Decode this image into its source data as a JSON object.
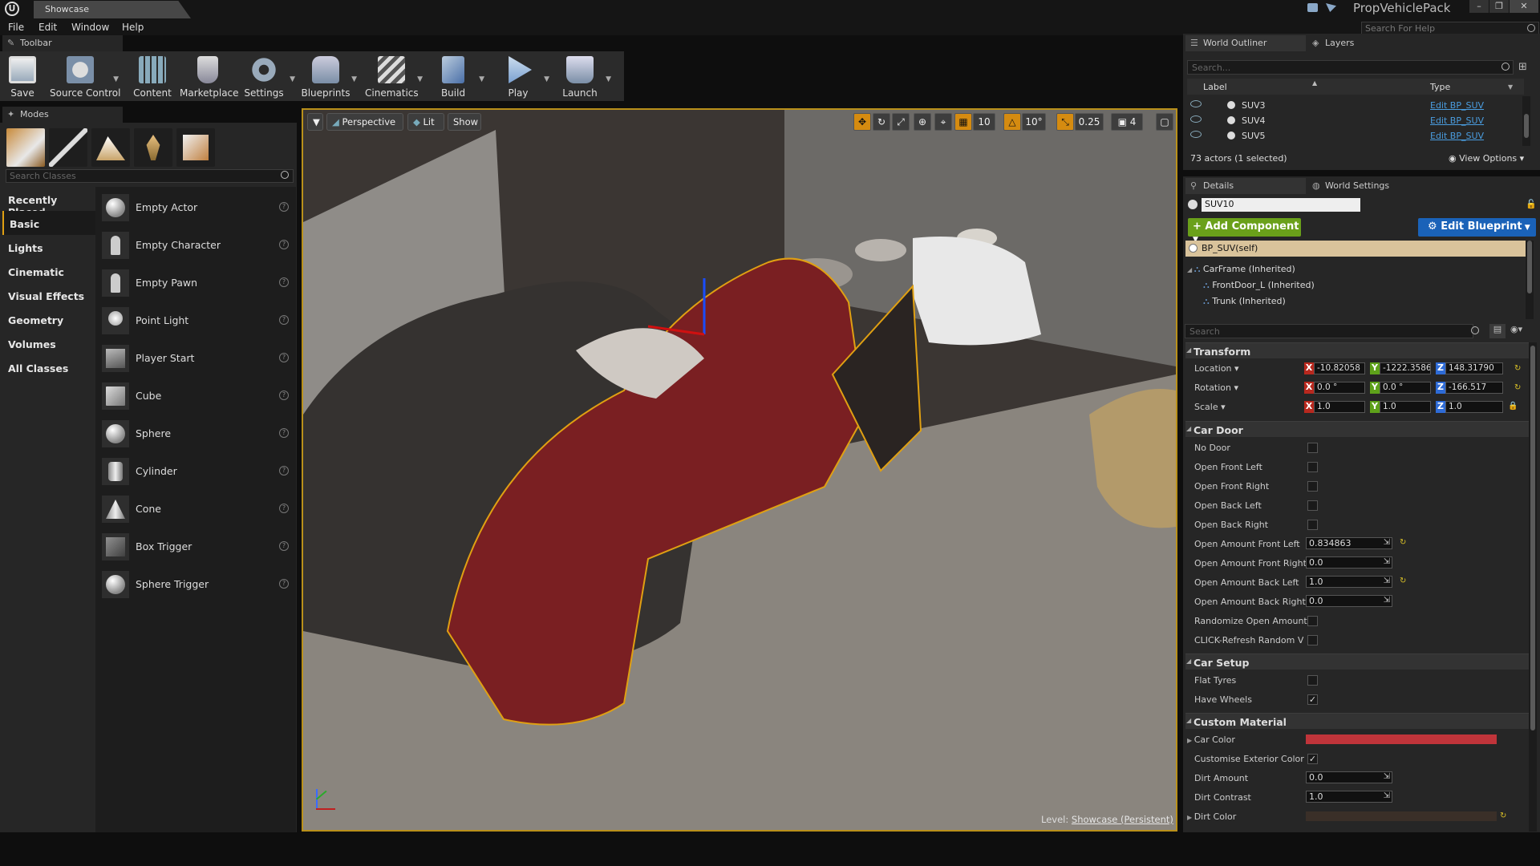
{
  "title_bar": {
    "document_tab": "Showcase",
    "project_name": "PropVehiclePack",
    "help_search_placeholder": "Search For Help"
  },
  "menu": [
    "File",
    "Edit",
    "Window",
    "Help"
  ],
  "toolbar": {
    "tab_label": "Toolbar",
    "buttons": [
      {
        "label": "Save",
        "icon": "save-icon"
      },
      {
        "label": "Source Control",
        "icon": "source-control-icon"
      },
      {
        "label": "Content",
        "icon": "content-browser-icon"
      },
      {
        "label": "Marketplace",
        "icon": "marketplace-icon"
      },
      {
        "label": "Settings",
        "icon": "settings-gear-icon"
      },
      {
        "label": "Blueprints",
        "icon": "blueprints-icon"
      },
      {
        "label": "Cinematics",
        "icon": "cinematics-clapper-icon"
      },
      {
        "label": "Build",
        "icon": "build-icon"
      },
      {
        "label": "Play",
        "icon": "play-icon"
      },
      {
        "label": "Launch",
        "icon": "launch-icon"
      }
    ]
  },
  "modes": {
    "tab_label": "Modes",
    "search_placeholder": "Search Classes",
    "categories": [
      "Recently Placed",
      "Basic",
      "Lights",
      "Cinematic",
      "Visual Effects",
      "Geometry",
      "Volumes",
      "All Classes"
    ],
    "selected_category": "Basic",
    "items": [
      "Empty Actor",
      "Empty Character",
      "Empty Pawn",
      "Point Light",
      "Player Start",
      "Cube",
      "Sphere",
      "Cylinder",
      "Cone",
      "Box Trigger",
      "Sphere Trigger"
    ]
  },
  "viewport": {
    "view_mode": "Perspective",
    "lighting": "Lit",
    "show": "Show",
    "grid_snap": "10",
    "rotation_snap": "10°",
    "scale_snap": "0.25",
    "camera_speed": "4",
    "level_label": "Level:",
    "level_name": "Showcase (Persistent)"
  },
  "world_outliner": {
    "tab_label": "World Outliner",
    "layers_tab": "Layers",
    "search_placeholder": "Search...",
    "col_label": "Label",
    "col_type": "Type",
    "rows": [
      {
        "label": "SUV3",
        "type": "Edit BP_SUV"
      },
      {
        "label": "SUV4",
        "type": "Edit BP_SUV"
      },
      {
        "label": "SUV5",
        "type": "Edit BP_SUV"
      }
    ],
    "actor_count": "73 actors (1 selected)",
    "view_options": "View Options"
  },
  "details": {
    "tab_label": "Details",
    "world_settings_tab": "World Settings",
    "actor_name": "SUV10",
    "add_component": "+ Add Component",
    "edit_blueprint": "Edit Blueprint",
    "components": [
      "BP_SUV(self)",
      "CarFrame (Inherited)",
      "FrontDoor_L (Inherited)",
      "Trunk (Inherited)"
    ],
    "search_placeholder": "Search",
    "transform": {
      "header": "Transform",
      "location_label": "Location",
      "rotation_label": "Rotation",
      "scale_label": "Scale",
      "location": [
        "-10.82058",
        "-1222.3586",
        "148.31790"
      ],
      "rotation": [
        "0.0 °",
        "0.0 °",
        "-166.517"
      ],
      "scale": [
        "1.0",
        "1.0",
        "1.0"
      ]
    },
    "car_door": {
      "header": "Car Door",
      "checkboxes": [
        {
          "label": "No Door",
          "checked": false
        },
        {
          "label": "Open Front Left",
          "checked": false
        },
        {
          "label": "Open Front Right",
          "checked": false
        },
        {
          "label": "Open Back Left",
          "checked": false
        },
        {
          "label": "Open Back Right",
          "checked": false
        }
      ],
      "amounts": [
        {
          "label": "Open Amount Front Left",
          "value": "0.834863"
        },
        {
          "label": "Open Amount Front Right",
          "value": "0.0"
        },
        {
          "label": "Open Amount Back Left",
          "value": "1.0"
        },
        {
          "label": "Open Amount Back Right",
          "value": "0.0"
        }
      ],
      "randomize_label": "Randomize Open Amount",
      "refresh_label": "CLICK-Refresh Random Va"
    },
    "car_setup": {
      "header": "Car Setup",
      "flat_tyres": "Flat Tyres",
      "flat_tyres_checked": false,
      "have_wheels": "Have Wheels",
      "have_wheels_checked": true
    },
    "custom_material": {
      "header": "Custom Material",
      "car_color_label": "Car Color",
      "car_color": "#c0343a",
      "customise_label": "Customise Exterior Color",
      "customise_checked": true,
      "dirt_amount_label": "Dirt Amount",
      "dirt_amount": "0.0",
      "dirt_contrast_label": "Dirt Contrast",
      "dirt_contrast": "1.0",
      "dirt_color_label": "Dirt Color",
      "dirt_color": "#3a2f28"
    }
  },
  "colors": {
    "selection_outline": "#e0a012",
    "add_component_green": "#6aa01a",
    "edit_blueprint_blue": "#1a62b8",
    "link_blue": "#4a9de0"
  }
}
